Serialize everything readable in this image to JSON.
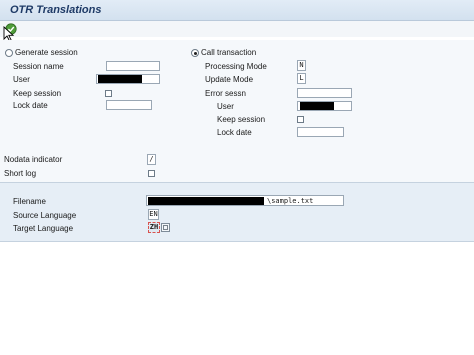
{
  "title": "OTR Translations",
  "toolbar": {
    "execute_icon": "execute-icon"
  },
  "left": {
    "generate_session_label": "Generate session",
    "session_name_label": "Session name",
    "session_name_value": "",
    "user_label": "User",
    "keep_session_label": "Keep session",
    "lock_date_label": "Lock date",
    "lock_date_value": ""
  },
  "right": {
    "call_transaction_label": "Call transaction",
    "processing_mode_label": "Processing Mode",
    "processing_mode_value": "N",
    "update_mode_label": "Update Mode",
    "update_mode_value": "L",
    "error_sessn_label": "Error sessn",
    "error_sessn_value": "",
    "user_label": "User",
    "keep_session_label": "Keep session",
    "lock_date_label": "Lock date",
    "lock_date_value": ""
  },
  "options": {
    "nodata_indicator_label": "Nodata indicator",
    "nodata_indicator_value": "/",
    "short_log_label": "Short log"
  },
  "files": {
    "filename_label": "Filename",
    "filename_value": "\\sample.txt",
    "source_language_label": "Source Language",
    "source_language_value": "EN",
    "target_language_label": "Target Language",
    "target_language_value": "ZH"
  },
  "colors": {
    "title_text": "#1e3a66",
    "titlebar": "#d3e1ef",
    "group_bg": "#e6eef6",
    "focus_red": "#d9534f"
  }
}
